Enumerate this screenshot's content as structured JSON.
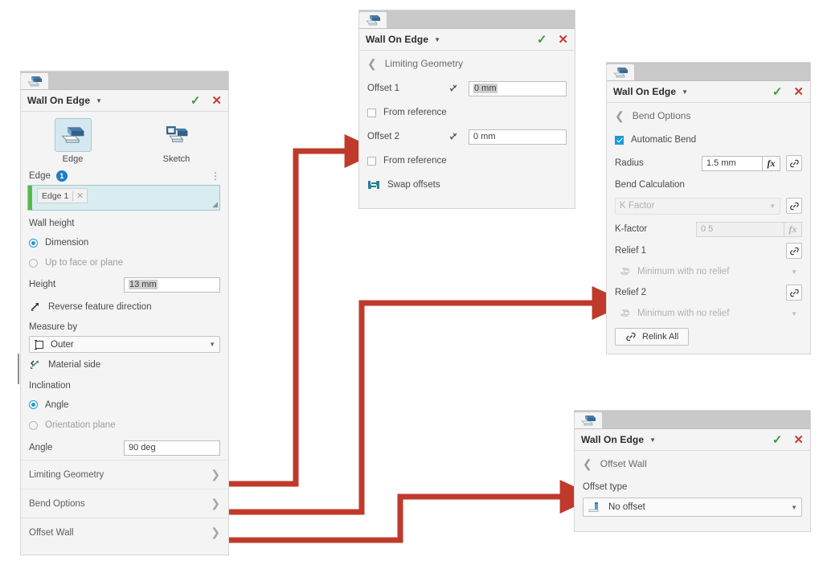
{
  "app": {
    "window_title": "Wall On Edge",
    "confirm_icon": "check-icon",
    "cancel_icon": "close-icon",
    "accent_red": "#cc3b34",
    "accent_green": "#3d9b35",
    "arrow_red": "#bf3a2b",
    "select_blue": "#1c9ad6"
  },
  "main_panel": {
    "title": "Wall On Edge",
    "type_buttons": [
      {
        "label": "Edge",
        "icon": "wall-on-edge-icon",
        "selected": true
      },
      {
        "label": "Sketch",
        "icon": "wall-on-sketch-icon",
        "selected": false
      }
    ],
    "edge_section": {
      "label": "Edge",
      "count": "1",
      "menu_icon": "kebab-menu-icon",
      "chip": {
        "label": "Edge 1",
        "remove_icon": "close-icon"
      },
      "resize_icon": "resize-grip-icon"
    },
    "wall_height": {
      "label": "Wall height",
      "options": [
        {
          "label": "Dimension",
          "selected": true
        },
        {
          "label": "Up to face or plane",
          "selected": false
        }
      ],
      "height_label": "Height",
      "height_value": "13 mm",
      "reverse_label": "Reverse feature direction",
      "reverse_icon": "reverse-direction-icon"
    },
    "measure_by": {
      "label": "Measure by",
      "value": "Outer",
      "icon": "measure-outer-icon",
      "arrow_icon": "chevron-down-icon"
    },
    "material_side": {
      "label": "Material side",
      "icon": "material-side-icon"
    },
    "inclination": {
      "label": "Inclination",
      "options": [
        {
          "label": "Angle",
          "selected": true
        },
        {
          "label": "Orientation plane",
          "selected": false
        }
      ],
      "angle_label": "Angle",
      "angle_value": "90 deg"
    },
    "sections": [
      {
        "label": "Limiting Geometry",
        "chevron_icon": "chevron-right-icon"
      },
      {
        "label": "Bend Options",
        "chevron_icon": "chevron-right-icon"
      },
      {
        "label": "Offset Wall",
        "chevron_icon": "chevron-right-icon"
      }
    ]
  },
  "limiting_geometry_panel": {
    "title": "Wall On Edge",
    "heading": "Limiting Geometry",
    "back_icon": "chevron-left-icon",
    "offset1": {
      "label": "Offset 1",
      "value": "0 mm",
      "icon": "measure-offset-icon",
      "selected_text": true
    },
    "from_reference_1": {
      "label": "From reference",
      "checked": false
    },
    "offset2": {
      "label": "Offset 2",
      "value": "0 mm",
      "icon": "measure-offset-icon",
      "selected_text": false
    },
    "from_reference_2": {
      "label": "From reference",
      "checked": false
    },
    "swap": {
      "label": "Swap offsets",
      "icon": "swap-offsets-icon"
    }
  },
  "bend_options_panel": {
    "title": "Wall On Edge",
    "heading": "Bend Options",
    "back_icon": "chevron-left-icon",
    "automatic_bend": {
      "label": "Automatic Bend",
      "checked": true
    },
    "radius": {
      "label": "Radius",
      "value": "1.5 mm",
      "fx_label": "fx",
      "link_icon": "link-icon"
    },
    "bend_calculation": {
      "label": "Bend Calculation",
      "value": "K Factor",
      "link_icon": "link-icon",
      "arrow_icon": "chevron-down-icon",
      "disabled": true
    },
    "k_factor": {
      "label": "K-factor",
      "value": "0 5",
      "fx_label": "fx",
      "disabled": true
    },
    "relief1": {
      "label": "Relief 1",
      "value": "Minimum with no relief",
      "icon": "relief-icon",
      "link_icon": "link-icon",
      "arrow_icon": "chevron-down-icon",
      "disabled": true
    },
    "relief2": {
      "label": "Relief 2",
      "value": "Minimum with no relief",
      "icon": "relief-icon",
      "link_icon": "link-icon",
      "arrow_icon": "chevron-down-icon",
      "disabled": true
    },
    "relink_all": {
      "label": "Relink All",
      "icon": "link-icon"
    }
  },
  "offset_wall_panel": {
    "title": "Wall On Edge",
    "heading": "Offset Wall",
    "back_icon": "chevron-left-icon",
    "offset_type": {
      "label": "Offset type",
      "value": "No offset",
      "icon": "no-offset-icon",
      "arrow_icon": "chevron-down-icon"
    }
  },
  "connectors": [
    {
      "from": "Limiting Geometry",
      "to": "limiting_geometry_panel",
      "arrow_icon": "arrow-right-icon"
    },
    {
      "from": "Bend Options",
      "to": "bend_options_panel",
      "arrow_icon": "arrow-right-icon"
    },
    {
      "from": "Offset Wall",
      "to": "offset_wall_panel",
      "arrow_icon": "arrow-right-icon"
    }
  ]
}
